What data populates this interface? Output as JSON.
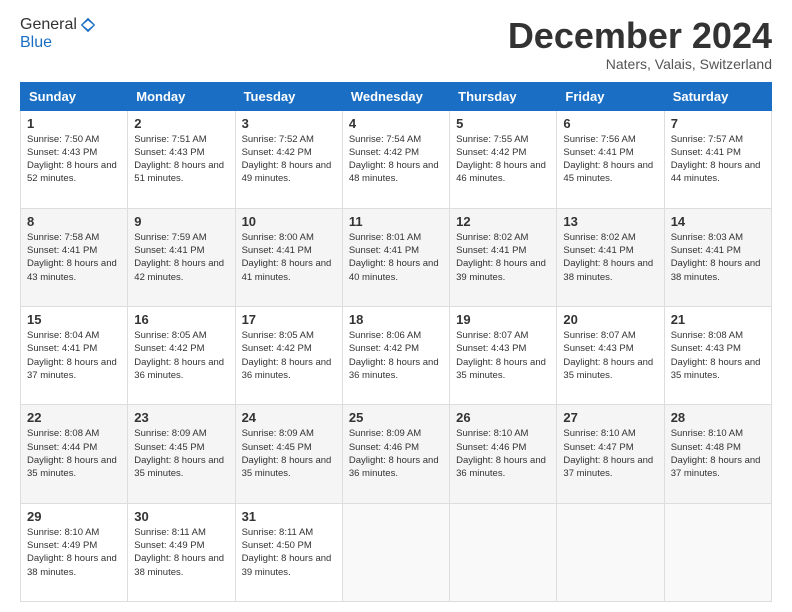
{
  "logo": {
    "line1": "General",
    "line2": "Blue"
  },
  "header": {
    "title": "December 2024",
    "location": "Naters, Valais, Switzerland"
  },
  "weekdays": [
    "Sunday",
    "Monday",
    "Tuesday",
    "Wednesday",
    "Thursday",
    "Friday",
    "Saturday"
  ],
  "weeks": [
    [
      {
        "day": "1",
        "sunrise": "Sunrise: 7:50 AM",
        "sunset": "Sunset: 4:43 PM",
        "daylight": "Daylight: 8 hours and 52 minutes."
      },
      {
        "day": "2",
        "sunrise": "Sunrise: 7:51 AM",
        "sunset": "Sunset: 4:43 PM",
        "daylight": "Daylight: 8 hours and 51 minutes."
      },
      {
        "day": "3",
        "sunrise": "Sunrise: 7:52 AM",
        "sunset": "Sunset: 4:42 PM",
        "daylight": "Daylight: 8 hours and 49 minutes."
      },
      {
        "day": "4",
        "sunrise": "Sunrise: 7:54 AM",
        "sunset": "Sunset: 4:42 PM",
        "daylight": "Daylight: 8 hours and 48 minutes."
      },
      {
        "day": "5",
        "sunrise": "Sunrise: 7:55 AM",
        "sunset": "Sunset: 4:42 PM",
        "daylight": "Daylight: 8 hours and 46 minutes."
      },
      {
        "day": "6",
        "sunrise": "Sunrise: 7:56 AM",
        "sunset": "Sunset: 4:41 PM",
        "daylight": "Daylight: 8 hours and 45 minutes."
      },
      {
        "day": "7",
        "sunrise": "Sunrise: 7:57 AM",
        "sunset": "Sunset: 4:41 PM",
        "daylight": "Daylight: 8 hours and 44 minutes."
      }
    ],
    [
      {
        "day": "8",
        "sunrise": "Sunrise: 7:58 AM",
        "sunset": "Sunset: 4:41 PM",
        "daylight": "Daylight: 8 hours and 43 minutes."
      },
      {
        "day": "9",
        "sunrise": "Sunrise: 7:59 AM",
        "sunset": "Sunset: 4:41 PM",
        "daylight": "Daylight: 8 hours and 42 minutes."
      },
      {
        "day": "10",
        "sunrise": "Sunrise: 8:00 AM",
        "sunset": "Sunset: 4:41 PM",
        "daylight": "Daylight: 8 hours and 41 minutes."
      },
      {
        "day": "11",
        "sunrise": "Sunrise: 8:01 AM",
        "sunset": "Sunset: 4:41 PM",
        "daylight": "Daylight: 8 hours and 40 minutes."
      },
      {
        "day": "12",
        "sunrise": "Sunrise: 8:02 AM",
        "sunset": "Sunset: 4:41 PM",
        "daylight": "Daylight: 8 hours and 39 minutes."
      },
      {
        "day": "13",
        "sunrise": "Sunrise: 8:02 AM",
        "sunset": "Sunset: 4:41 PM",
        "daylight": "Daylight: 8 hours and 38 minutes."
      },
      {
        "day": "14",
        "sunrise": "Sunrise: 8:03 AM",
        "sunset": "Sunset: 4:41 PM",
        "daylight": "Daylight: 8 hours and 38 minutes."
      }
    ],
    [
      {
        "day": "15",
        "sunrise": "Sunrise: 8:04 AM",
        "sunset": "Sunset: 4:41 PM",
        "daylight": "Daylight: 8 hours and 37 minutes."
      },
      {
        "day": "16",
        "sunrise": "Sunrise: 8:05 AM",
        "sunset": "Sunset: 4:42 PM",
        "daylight": "Daylight: 8 hours and 36 minutes."
      },
      {
        "day": "17",
        "sunrise": "Sunrise: 8:05 AM",
        "sunset": "Sunset: 4:42 PM",
        "daylight": "Daylight: 8 hours and 36 minutes."
      },
      {
        "day": "18",
        "sunrise": "Sunrise: 8:06 AM",
        "sunset": "Sunset: 4:42 PM",
        "daylight": "Daylight: 8 hours and 36 minutes."
      },
      {
        "day": "19",
        "sunrise": "Sunrise: 8:07 AM",
        "sunset": "Sunset: 4:43 PM",
        "daylight": "Daylight: 8 hours and 35 minutes."
      },
      {
        "day": "20",
        "sunrise": "Sunrise: 8:07 AM",
        "sunset": "Sunset: 4:43 PM",
        "daylight": "Daylight: 8 hours and 35 minutes."
      },
      {
        "day": "21",
        "sunrise": "Sunrise: 8:08 AM",
        "sunset": "Sunset: 4:43 PM",
        "daylight": "Daylight: 8 hours and 35 minutes."
      }
    ],
    [
      {
        "day": "22",
        "sunrise": "Sunrise: 8:08 AM",
        "sunset": "Sunset: 4:44 PM",
        "daylight": "Daylight: 8 hours and 35 minutes."
      },
      {
        "day": "23",
        "sunrise": "Sunrise: 8:09 AM",
        "sunset": "Sunset: 4:45 PM",
        "daylight": "Daylight: 8 hours and 35 minutes."
      },
      {
        "day": "24",
        "sunrise": "Sunrise: 8:09 AM",
        "sunset": "Sunset: 4:45 PM",
        "daylight": "Daylight: 8 hours and 35 minutes."
      },
      {
        "day": "25",
        "sunrise": "Sunrise: 8:09 AM",
        "sunset": "Sunset: 4:46 PM",
        "daylight": "Daylight: 8 hours and 36 minutes."
      },
      {
        "day": "26",
        "sunrise": "Sunrise: 8:10 AM",
        "sunset": "Sunset: 4:46 PM",
        "daylight": "Daylight: 8 hours and 36 minutes."
      },
      {
        "day": "27",
        "sunrise": "Sunrise: 8:10 AM",
        "sunset": "Sunset: 4:47 PM",
        "daylight": "Daylight: 8 hours and 37 minutes."
      },
      {
        "day": "28",
        "sunrise": "Sunrise: 8:10 AM",
        "sunset": "Sunset: 4:48 PM",
        "daylight": "Daylight: 8 hours and 37 minutes."
      }
    ],
    [
      {
        "day": "29",
        "sunrise": "Sunrise: 8:10 AM",
        "sunset": "Sunset: 4:49 PM",
        "daylight": "Daylight: 8 hours and 38 minutes."
      },
      {
        "day": "30",
        "sunrise": "Sunrise: 8:11 AM",
        "sunset": "Sunset: 4:49 PM",
        "daylight": "Daylight: 8 hours and 38 minutes."
      },
      {
        "day": "31",
        "sunrise": "Sunrise: 8:11 AM",
        "sunset": "Sunset: 4:50 PM",
        "daylight": "Daylight: 8 hours and 39 minutes."
      },
      null,
      null,
      null,
      null
    ]
  ]
}
